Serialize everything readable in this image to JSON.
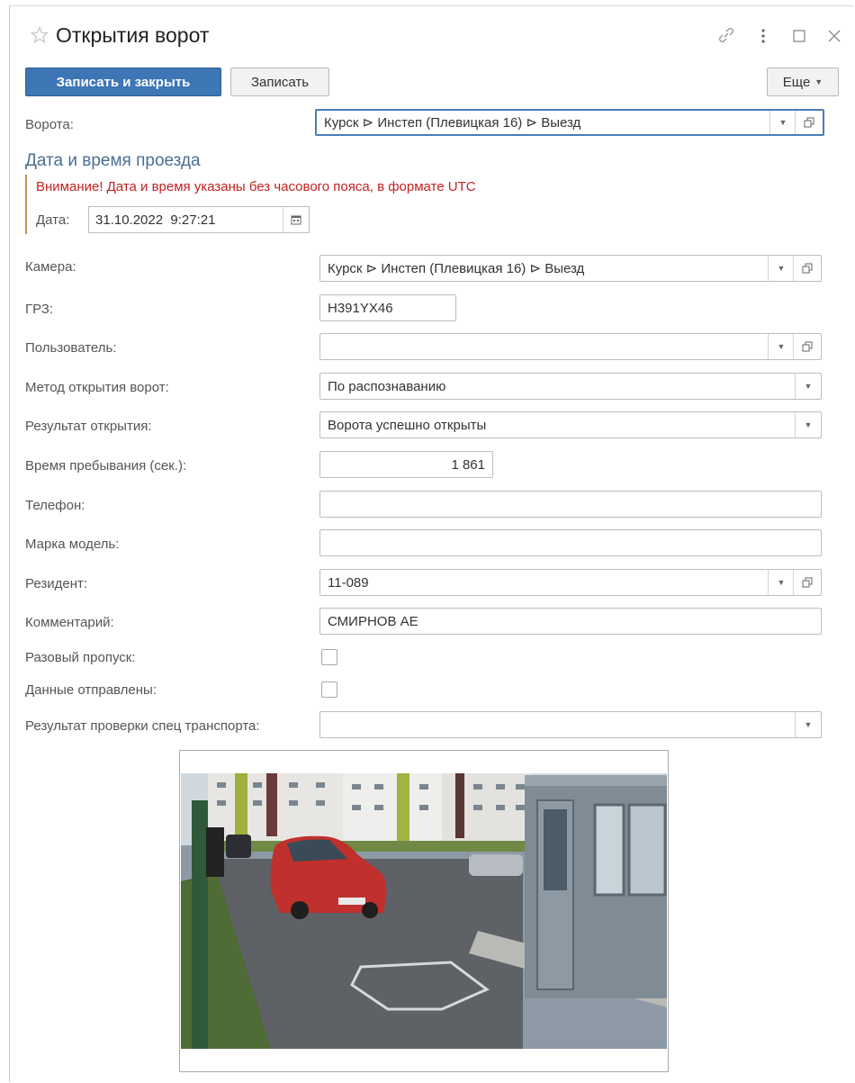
{
  "window": {
    "title": "Открытия ворот",
    "icons": [
      "star-icon",
      "link-icon",
      "more-vertical-icon",
      "maximize-icon",
      "close-icon"
    ]
  },
  "toolbar": {
    "save_close_label": "Записать и закрыть",
    "save_label": "Записать",
    "more_label": "Еще"
  },
  "form": {
    "gates": {
      "label": "Ворота:",
      "value": "Курск ⊳ Инстеп (Плевицкая 16) ⊳ Выезд"
    },
    "section": {
      "title": "Дата и время проезда",
      "warning": "Внимание! Дата и время указаны без часового пояса, в формате UTC",
      "date_label": "Дата:",
      "date_value": "31.10.2022  9:27:21"
    },
    "camera": {
      "label": "Камера:",
      "value": "Курск ⊳ Инстеп (Плевицкая 16) ⊳ Выезд"
    },
    "plate": {
      "label": "ГРЗ:",
      "value": "Н391YX46"
    },
    "user": {
      "label": "Пользователь:",
      "value": ""
    },
    "method": {
      "label": "Метод открытия ворот:",
      "value": "По распознаванию"
    },
    "result": {
      "label": "Результат открытия:",
      "value": "Ворота успешно открыты"
    },
    "stay": {
      "label": "Время пребывания (сек.):",
      "value": "1 861"
    },
    "phone": {
      "label": "Телефон:",
      "value": ""
    },
    "model": {
      "label": "Марка модель:",
      "value": ""
    },
    "resident": {
      "label": "Резидент:",
      "value": "11-089"
    },
    "comment": {
      "label": "Комментарий:",
      "value": "СМИРНОВ АЕ"
    },
    "one_time_pass": {
      "label": "Разовый пропуск:",
      "checked": false
    },
    "data_sent": {
      "label": "Данные отправлены:",
      "checked": false
    },
    "special_check": {
      "label": "Результат проверки спец транспорта:",
      "value": ""
    }
  },
  "colors": {
    "primary_button": "#3d75b5",
    "section_title": "#4b6d96",
    "warning_text": "#c22222",
    "group_bar": "#c99053"
  }
}
